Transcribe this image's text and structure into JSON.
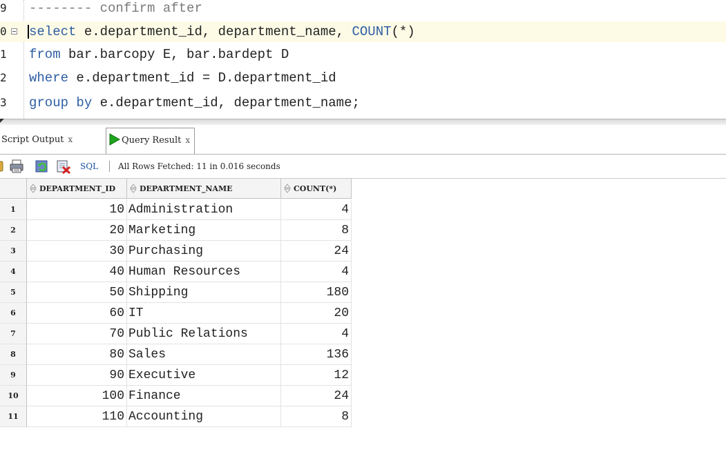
{
  "editor": {
    "lines": [
      {
        "num": "9",
        "prefix": "",
        "keyword": "",
        "code": "",
        "comment": "-------- confirm after",
        "suffix_keyword": "",
        "suffix": ""
      },
      {
        "num": "0",
        "prefix": "",
        "keyword": "select",
        "code": " e.department_id, department_name, ",
        "comment": "",
        "suffix_keyword": "COUNT",
        "suffix": "(*)"
      },
      {
        "num": "1",
        "prefix": "",
        "keyword": "from",
        "code": " bar.barcopy E, bar.bardept D",
        "comment": "",
        "suffix_keyword": "",
        "suffix": ""
      },
      {
        "num": "2",
        "prefix": "",
        "keyword": "where",
        "code": " e.department_id = D.department_id",
        "comment": "",
        "suffix_keyword": "",
        "suffix": ""
      },
      {
        "num": "3",
        "prefix": "",
        "keyword": "group by",
        "code": " e.department_id, department_name;",
        "comment": "",
        "suffix_keyword": "",
        "suffix": ""
      }
    ]
  },
  "tabs": {
    "script_output": {
      "label": "Script Output",
      "close": "x"
    },
    "query_result": {
      "label": "Query Result",
      "close": "x"
    }
  },
  "toolbar": {
    "sql_label": "SQL",
    "status": "All Rows Fetched: 11 in 0.016 seconds",
    "icons": [
      "pin-icon",
      "print-icon",
      "refresh-icon",
      "delete-icon"
    ]
  },
  "grid": {
    "columns": [
      "DEPARTMENT_ID",
      "DEPARTMENT_NAME",
      "COUNT(*)"
    ],
    "rows": [
      {
        "rn": "1",
        "id": "10",
        "name": "Administration",
        "count": "4"
      },
      {
        "rn": "2",
        "id": "20",
        "name": "Marketing",
        "count": "8"
      },
      {
        "rn": "3",
        "id": "30",
        "name": "Purchasing",
        "count": "24"
      },
      {
        "rn": "4",
        "id": "40",
        "name": "Human Resources",
        "count": "4"
      },
      {
        "rn": "5",
        "id": "50",
        "name": "Shipping",
        "count": "180"
      },
      {
        "rn": "6",
        "id": "60",
        "name": "IT",
        "count": "20"
      },
      {
        "rn": "7",
        "id": "70",
        "name": "Public Relations",
        "count": "4"
      },
      {
        "rn": "8",
        "id": "80",
        "name": "Sales",
        "count": "136"
      },
      {
        "rn": "9",
        "id": "90",
        "name": "Executive",
        "count": "12"
      },
      {
        "rn": "10",
        "id": "100",
        "name": "Finance",
        "count": "24"
      },
      {
        "rn": "11",
        "id": "110",
        "name": "Accounting",
        "count": "8"
      }
    ]
  },
  "colors": {
    "keyword": "#2f5ea4",
    "comment": "#7a7a7a",
    "current_line": "#fdfbe6",
    "play_green": "#1ea51e",
    "sql_blue": "#1a4fa0"
  }
}
